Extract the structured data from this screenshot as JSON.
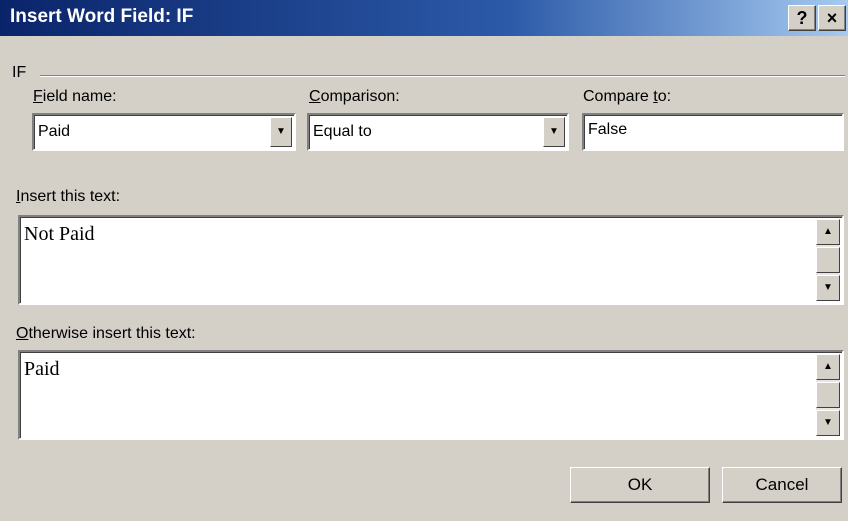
{
  "window": {
    "title": "Insert Word Field: IF",
    "help_glyph": "?",
    "close_glyph": "×"
  },
  "group": {
    "label": "IF"
  },
  "field_name": {
    "label_first": "F",
    "label_rest": "ield name:",
    "value": "Paid"
  },
  "comparison": {
    "label_first": "C",
    "label_rest": "omparison:",
    "value": "Equal to"
  },
  "compare_to": {
    "label_pre": "Compare ",
    "label_underlined": "t",
    "label_post": "o:",
    "value": "False"
  },
  "insert_text": {
    "label_first": "I",
    "label_rest": "nsert this text:",
    "value": "Not Paid"
  },
  "otherwise_text": {
    "label_first": "O",
    "label_rest": "therwise insert this text:",
    "value": "Paid"
  },
  "buttons": {
    "ok": "OK",
    "cancel": "Cancel"
  },
  "glyphs": {
    "down": "▼",
    "up": "▲"
  }
}
